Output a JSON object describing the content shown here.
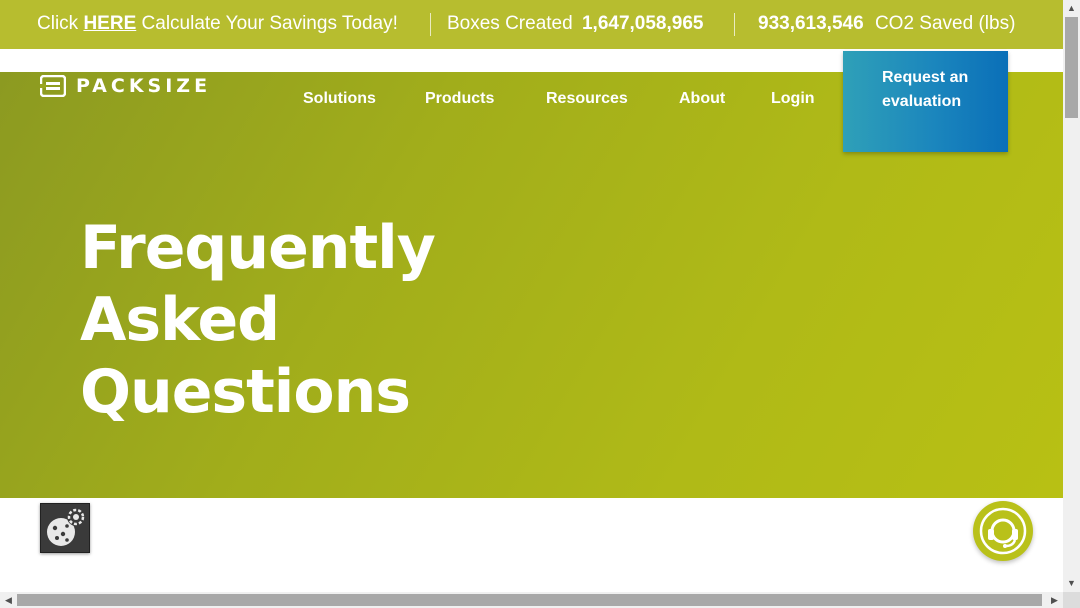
{
  "topbar": {
    "promo_prefix": "Click",
    "promo_link": "HERE",
    "promo_suffix": "Calculate Your Savings Today!",
    "boxes_label": "Boxes Created",
    "boxes_value": "1,647,058,965",
    "co2_value": "933,613,546",
    "co2_label": "CO2 Saved (lbs)"
  },
  "brand": {
    "name": "PACKSIZE"
  },
  "nav": {
    "items": [
      "Solutions",
      "Products",
      "Resources",
      "About",
      "Login"
    ]
  },
  "cta": {
    "label": "Request an evaluation"
  },
  "hero": {
    "title_lines": [
      "Frequently",
      "Asked",
      "Questions"
    ]
  },
  "colors": {
    "topbar": "#b7bd2f",
    "hero_start": "#8c9a21",
    "hero_end": "#b8c014",
    "cta_start": "#2fa0b8",
    "cta_end": "#0a6fb8",
    "chat": "#b9c11a"
  },
  "icons": {
    "cookie": "cookie-settings-icon",
    "chat": "support-headset-icon",
    "logo": "packsize-logo-mark"
  }
}
